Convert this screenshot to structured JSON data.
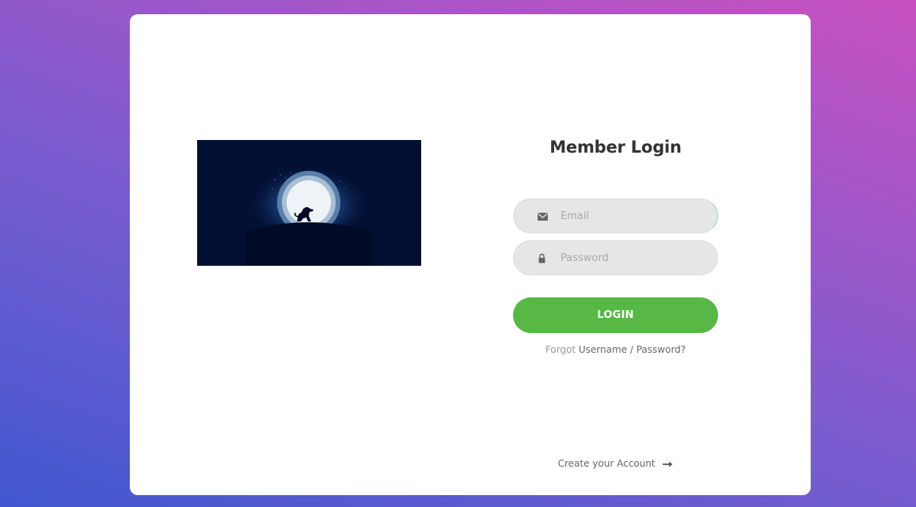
{
  "login": {
    "title": "Member Login",
    "email_placeholder": "Email",
    "password_placeholder": "Password",
    "button_label": "LOGIN",
    "forgot_prefix": "Forgot",
    "forgot_username": "Username",
    "forgot_separator": "/",
    "forgot_password": "Password?",
    "create_account": "Create your Account"
  },
  "icons": {
    "email": "envelope-icon",
    "password": "lock-icon",
    "create": "arrow-right-icon"
  },
  "colors": {
    "background_start": "#4158d0",
    "background_end": "#c850c0",
    "button": "#57b846",
    "field": "#e6e6e6",
    "hero_background": "#030f33"
  }
}
